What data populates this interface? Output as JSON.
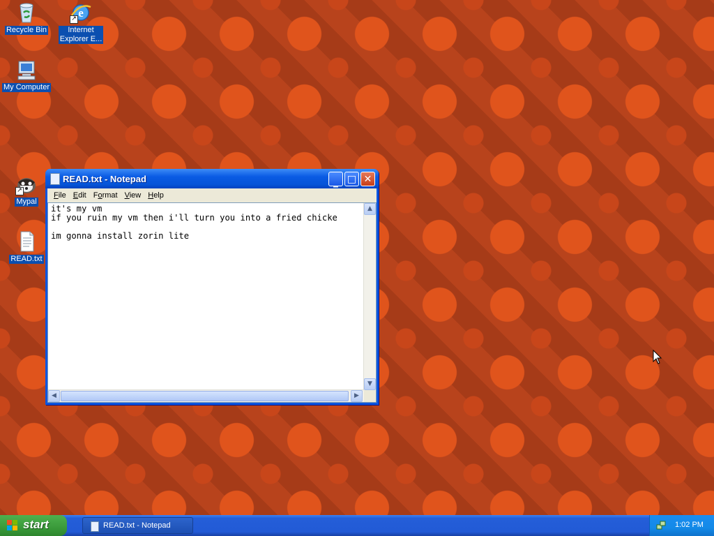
{
  "desktop": {
    "icons": [
      {
        "label": "Recycle Bin",
        "icon": "recycle-bin-icon"
      },
      {
        "label": "Internet\nExplorer E...",
        "label_line1": "Internet",
        "label_line2": "Explorer E...",
        "icon": "internet-explorer-icon"
      },
      {
        "label": "My Computer",
        "icon": "my-computer-icon"
      },
      {
        "label": "Mypal",
        "icon": "mypal-icon"
      },
      {
        "label": "READ.txt",
        "icon": "text-file-icon"
      }
    ]
  },
  "window": {
    "title": "READ.txt - Notepad",
    "menu": [
      {
        "label": "File",
        "key": "F",
        "rest": "ile"
      },
      {
        "label": "Edit",
        "key": "E",
        "rest": "dit"
      },
      {
        "label": "Format",
        "key": "o",
        "pre": "F",
        "rest": "rmat"
      },
      {
        "label": "View",
        "key": "V",
        "rest": "iew"
      },
      {
        "label": "Help",
        "key": "H",
        "rest": "elp"
      }
    ],
    "content": "it's my vm\nif you ruin my vm then i'll turn you into a fried chicke\n\nim gonna install zorin lite"
  },
  "taskbar": {
    "start_label": "start",
    "task_label": "READ.txt - Notepad",
    "clock": "1:02 PM"
  },
  "colors": {
    "taskbar_blue": "#245ed8",
    "start_green": "#3a9a3a",
    "desktop_orange": "#c8461a"
  }
}
